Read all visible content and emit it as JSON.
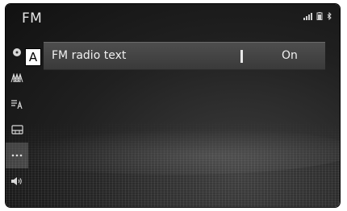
{
  "header": {
    "title": "FM"
  },
  "status_icons": [
    "signal-icon",
    "phone-battery-icon",
    "bluetooth-icon"
  ],
  "sidebar": {
    "items": [
      {
        "name": "sidebar-item-source",
        "icon": "disc-icon"
      },
      {
        "name": "sidebar-item-stations",
        "icon": "antenna-icon"
      },
      {
        "name": "sidebar-item-list",
        "icon": "list-icon"
      },
      {
        "name": "sidebar-item-presets",
        "icon": "preset-icon"
      },
      {
        "name": "sidebar-item-more",
        "icon": "more-icon",
        "active": true
      },
      {
        "name": "sidebar-item-sound",
        "icon": "speaker-icon"
      }
    ]
  },
  "settings": {
    "fm_radio_text": {
      "label": "FM radio text",
      "value": "On"
    }
  },
  "callout": {
    "label": "A"
  },
  "colors": {
    "screen_bg": "#1c1c1c",
    "row_bg": "#444444",
    "text": "#f0f0f0"
  }
}
